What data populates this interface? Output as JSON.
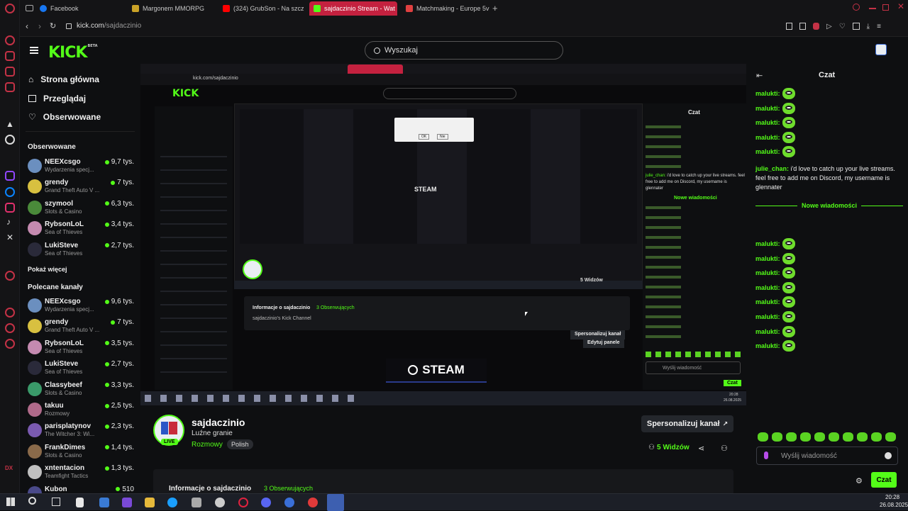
{
  "browser": {
    "tabs": [
      {
        "label": "Facebook",
        "color": "#1877f2"
      },
      {
        "label": "Margonem MMORPG",
        "color": "#c9a227"
      },
      {
        "label": "(324) GrubSon - Na szcz",
        "color": "#ff0000"
      },
      {
        "label": "sajdaczinio Stream - Wat",
        "color": "#53fc18",
        "active": true
      },
      {
        "label": "Matchmaking - Europe 5v",
        "color": "#e04040"
      }
    ],
    "url_host": "kick.com",
    "url_path": "/sajdaczinio"
  },
  "header": {
    "logo": "KICK",
    "logo_badge": "BETA",
    "search_placeholder": "Wyszukaj"
  },
  "nav": [
    {
      "label": "Strona główna",
      "icon": "home-icon"
    },
    {
      "label": "Przeglądaj",
      "icon": "browse-icon"
    },
    {
      "label": "Obserwowane",
      "icon": "heart-icon"
    }
  ],
  "followed": {
    "title": "Obserwowane",
    "channels": [
      {
        "name": "NEEXcsgo",
        "game": "Wydarzenia specj...",
        "viewers": "9,7 tys.",
        "color": "#6b8fbf"
      },
      {
        "name": "grendy",
        "game": "Grand Theft Auto V ...",
        "viewers": "7 tys.",
        "color": "#d8c040"
      },
      {
        "name": "szymool",
        "game": "Slots & Casino",
        "viewers": "6,3 tys.",
        "color": "#4a8a3a"
      },
      {
        "name": "RybsonLoL",
        "game": "Sea of Thieves",
        "viewers": "3,4 tys.",
        "color": "#c48ab0"
      },
      {
        "name": "LukiSteve",
        "game": "Sea of Thieves",
        "viewers": "2,7 tys.",
        "color": "#2a2a3a"
      }
    ],
    "more": "Pokaż więcej"
  },
  "recommended": {
    "title": "Polecane kanały",
    "channels": [
      {
        "name": "NEEXcsgo",
        "game": "Wydarzenia specj...",
        "viewers": "9,6 tys.",
        "color": "#6b8fbf"
      },
      {
        "name": "grendy",
        "game": "Grand Theft Auto V ...",
        "viewers": "7 tys.",
        "color": "#d8c040"
      },
      {
        "name": "RybsonLoL",
        "game": "Sea of Thieves",
        "viewers": "3,5 tys.",
        "color": "#c48ab0"
      },
      {
        "name": "LukiSteve",
        "game": "Sea of Thieves",
        "viewers": "2,7 tys.",
        "color": "#2a2a3a"
      },
      {
        "name": "Classybeef",
        "game": "Slots & Casino",
        "viewers": "3,3 tys.",
        "color": "#3a9a6a"
      },
      {
        "name": "takuu",
        "game": "Rozmowy",
        "viewers": "2,5 tys.",
        "color": "#b06a8a"
      },
      {
        "name": "parisplatynov",
        "game": "The Witcher 3: Wi...",
        "viewers": "2,3 tys.",
        "color": "#7a5ab0"
      },
      {
        "name": "FrankDimes",
        "game": "Slots & Casino",
        "viewers": "1,4 tys.",
        "color": "#8a6a4a"
      },
      {
        "name": "xntentacion",
        "game": "Teamfight Tactics",
        "viewers": "1,3 tys.",
        "color": "#c0c0c0"
      },
      {
        "name": "Kubon",
        "game": "",
        "viewers": "510",
        "color": "#4a4a8a"
      }
    ]
  },
  "stream_capture": {
    "nested_steam": "STEAM",
    "big_steam": "STEAM",
    "dialog_ok": "OK",
    "dialog_no": "Nie",
    "nested_chat_title": "Czat",
    "nested_new_messages": "Nowe wiadomości",
    "nested_message_user": "julie_chan:",
    "nested_message_text": "i'd love to catch up your live streams. feel free to add me on Discord, my username is glennater",
    "nested_placeholder": "Wyślij wiadomość",
    "nested_chat_button": "Czat",
    "nested_edit_panels": "Edytuj panele",
    "nested_info_title": "Informacje o sajdaczinio",
    "nested_followers": "3 Obserwujących",
    "nested_channel_desc": "sajdaczinio's Kick Channel",
    "nested_customize": "Spersonalizuj kanał",
    "nested_viewers": "5 Widzów",
    "nested_clock": "20:28",
    "nested_date": "26.08.2025"
  },
  "streamer": {
    "name": "sajdaczinio",
    "title": "Luźne granie",
    "category": "Rozmowy",
    "tag": "Polish",
    "live": "LIVE",
    "customize": "Spersonalizuj kanał",
    "viewers_count": "5",
    "viewers_label": "Widzów",
    "info_title": "Informacje o sajdaczinio",
    "followers": "3 Obserwujących"
  },
  "chat": {
    "title": "Czat",
    "messages_top": [
      "malukti:",
      "malukti:",
      "malukti:",
      "malukti:",
      "malukti:"
    ],
    "long_message": {
      "user": "julie_chan:",
      "text": "i'd love to catch up your live streams. feel free to add me on Discord, my username is glennater"
    },
    "divider": "Nowe wiadomości",
    "messages_bottom": [
      "malukti:",
      "malukti:",
      "malukti:",
      "malukti:",
      "malukti:",
      "malukti:",
      "malukti:",
      "malukti:"
    ],
    "placeholder": "Wyślij wiadomość",
    "send": "Czat"
  },
  "taskbar": {
    "time": "20:28",
    "date": "26.08.2025"
  },
  "colors": {
    "accent": "#53fc18",
    "opera": "#c4213f"
  }
}
